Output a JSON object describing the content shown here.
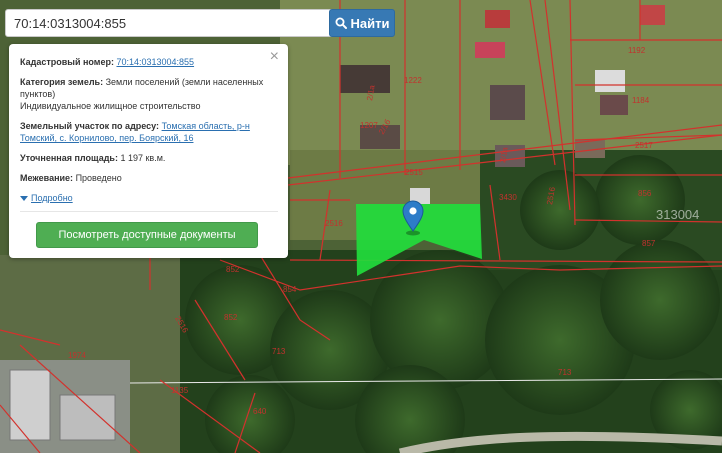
{
  "search": {
    "value": "70:14:0313004:855",
    "button_label": "Найти"
  },
  "info": {
    "cadastral_label": "Кадастровый номер:",
    "cadastral_value": "70:14:0313004:855",
    "category_label": "Категория земель:",
    "category_value": "Земли поселений (земли населенных пунктов)",
    "usage": "Индивидуальное жилищное строительство",
    "address_label": "Земельный участок по адресу:",
    "address_value": "Томская область, р-н Томский, с. Корнилово, пер. Боярский, 16",
    "area_label": "Уточненная площадь:",
    "area_value": "1 197 кв.м.",
    "survey_label": "Межевание:",
    "survey_value": "Проведено",
    "details_label": "Подробно",
    "docs_button": "Посмотреть доступные документы"
  },
  "map": {
    "parcel_labels": [
      "1192",
      "1222",
      "1184",
      "1207",
      "2517",
      "2515",
      "3430",
      "856",
      "2516",
      "857",
      "852",
      "854",
      "852",
      "713",
      "1974",
      "713",
      "1135",
      "640"
    ],
    "rotated_labels": [
      "2/1а",
      "2/1б",
      "2/1а",
      "2516",
      "2516",
      "640"
    ],
    "quarter_label": "313004",
    "colors": {
      "parcel_highlight": "#22dc3c",
      "boundary": "#d2322d",
      "marker": "#2d7cc8"
    }
  }
}
